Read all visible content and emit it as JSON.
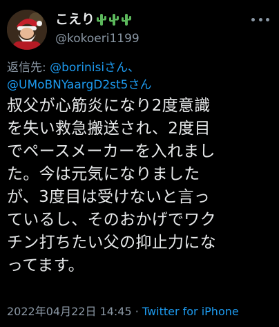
{
  "user": {
    "display_name": "こえり",
    "handle": "@kokoeri1199",
    "name_emoji": [
      "cactus-icon",
      "cactus-icon",
      "cactus-icon"
    ]
  },
  "reply": {
    "prefix": "返信先: ",
    "mention1": "@borinisiさん、",
    "mention2": "@UMoBNYaargD2st5さん"
  },
  "tweet": {
    "text": "叔父が心筋炎になり2度意識\nを失い救急搬送され、2度目\nでペースメーカーを入れまし\nた。今は元気になりました\nが、3度目は受けないと言っ\nているし、そのおかげでワク\nチン打ちたい父の抑止力にな\nってます。"
  },
  "meta": {
    "timestamp": "2022年04月22日 14:45",
    "separator": " · ",
    "source": "Twitter for iPhone"
  },
  "colors": {
    "background": "#000000",
    "text": "#e7e9ea",
    "secondary": "#8b98a5",
    "link": "#1d9bf0"
  }
}
